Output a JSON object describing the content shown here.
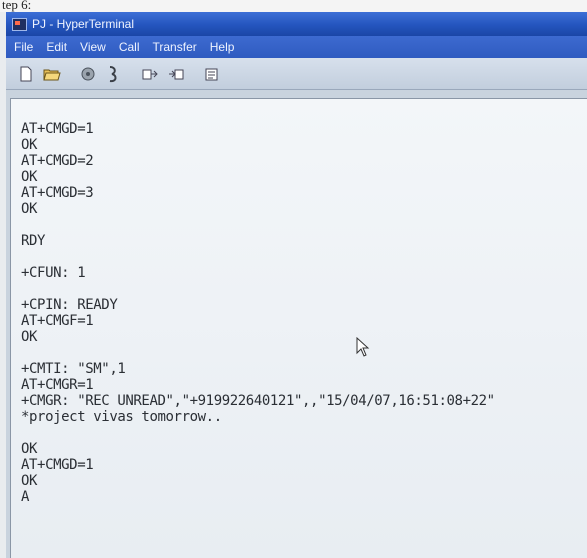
{
  "page_caption": "tep 6:",
  "window": {
    "title": "PJ - HyperTerminal",
    "menu": [
      "File",
      "Edit",
      "View",
      "Call",
      "Transfer",
      "Help"
    ],
    "toolbar_icons": [
      "new-icon",
      "open-icon",
      "disconnect-icon",
      "properties-call-icon",
      "send-icon",
      "receive-icon",
      "properties-icon"
    ]
  },
  "terminal": {
    "lines": [
      "",
      "AT+CMGD=1",
      "OK",
      "AT+CMGD=2",
      "OK",
      "AT+CMGD=3",
      "OK",
      "",
      "RDY",
      "",
      "+CFUN: 1",
      "",
      "+CPIN: READY",
      "AT+CMGF=1",
      "OK",
      "",
      "+CMTI: \"SM\",1",
      "AT+CMGR=1",
      "+CMGR: \"REC UNREAD\",\"+919922640121\",,\"15/04/07,16:51:08+22\"",
      "*project vivas tomorrow..",
      "",
      "OK",
      "AT+CMGD=1",
      "OK",
      "A"
    ]
  },
  "colors": {
    "titlebar": "#2455be",
    "menubar": "#2f5bc0",
    "terminal_bg": "#eef2f6",
    "terminal_text": "#2b2f35"
  }
}
